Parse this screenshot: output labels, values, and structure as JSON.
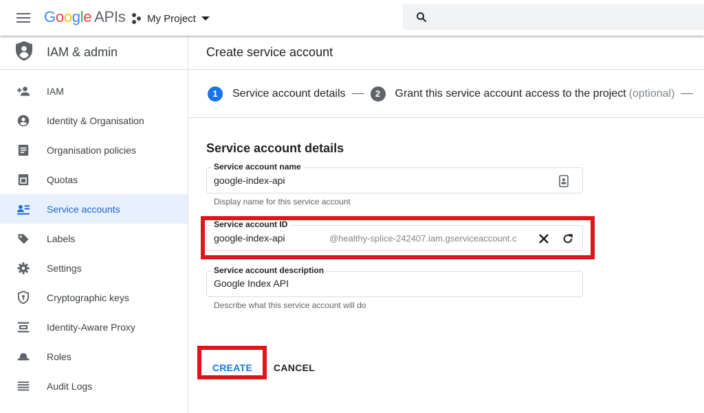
{
  "header": {
    "brand_letters": [
      "G",
      "o",
      "o",
      "g",
      "l",
      "e"
    ],
    "brand_suffix": "APIs",
    "project_label": "My Project"
  },
  "sidebar": {
    "title": "IAM & admin",
    "items": [
      {
        "label": "IAM",
        "icon": "person-add-icon"
      },
      {
        "label": "Identity & Organisation",
        "icon": "account-circle-icon"
      },
      {
        "label": "Organisation policies",
        "icon": "policy-document-icon"
      },
      {
        "label": "Quotas",
        "icon": "quota-icon"
      },
      {
        "label": "Service accounts",
        "icon": "service-account-icon",
        "active": true
      },
      {
        "label": "Labels",
        "icon": "label-tag-icon"
      },
      {
        "label": "Settings",
        "icon": "gear-icon"
      },
      {
        "label": "Cryptographic keys",
        "icon": "shield-key-icon"
      },
      {
        "label": "Identity-Aware Proxy",
        "icon": "proxy-icon"
      },
      {
        "label": "Roles",
        "icon": "roles-hat-icon"
      },
      {
        "label": "Audit Logs",
        "icon": "list-icon"
      }
    ]
  },
  "main": {
    "page_title": "Create service account",
    "stepper": {
      "step1_num": "1",
      "step1_label": "Service account details",
      "step2_num": "2",
      "step2_label": "Grant this service account access to the project",
      "step2_optional": "(optional)"
    },
    "section_title": "Service account details",
    "name_field": {
      "label": "Service account name",
      "value": "google-index-api",
      "hint": "Display name for this service account"
    },
    "id_field": {
      "label": "Service account ID",
      "value": "google-index-api",
      "suffix": "@healthy-splice-242407.iam.gserviceaccount.c"
    },
    "description_field": {
      "label": "Service account description",
      "value": "Google Index API",
      "hint": "Describe what this service account will do"
    },
    "buttons": {
      "create": "CREATE",
      "cancel": "CANCEL"
    }
  },
  "colors": {
    "accent": "#1a73e8",
    "active_bg": "#e8f0fe",
    "highlight": "#e3131b"
  }
}
